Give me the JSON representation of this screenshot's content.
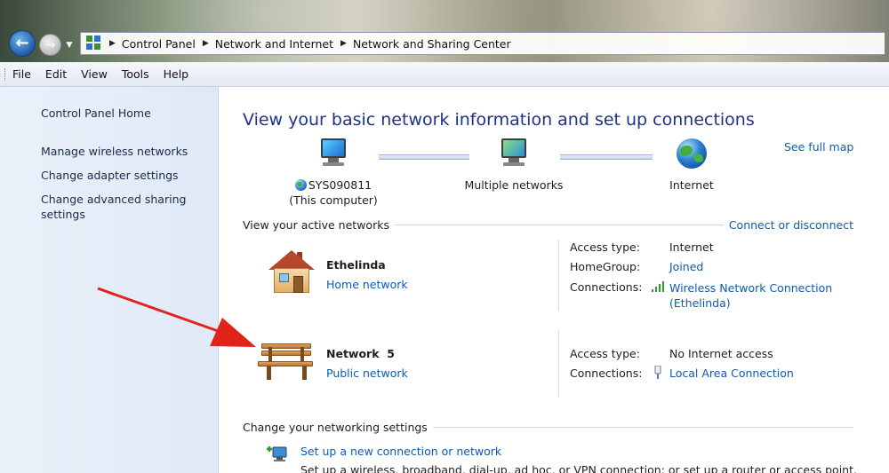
{
  "window": {
    "breadcrumbs": [
      "Control Panel",
      "Network and Internet",
      "Network and Sharing Center"
    ]
  },
  "menu": [
    "File",
    "Edit",
    "View",
    "Tools",
    "Help"
  ],
  "sidebar": {
    "home": "Control Panel Home",
    "links": [
      "Manage wireless networks",
      "Change adapter settings",
      "Change advanced sharing settings"
    ]
  },
  "main": {
    "heading": "View your basic network information and set up connections",
    "see_full_map": "See full map",
    "map": {
      "computer_name": "SYS090811",
      "computer_sub": "(This computer)",
      "middle": "Multiple networks",
      "internet": "Internet"
    },
    "active_networks": {
      "title": "View your active networks",
      "action": "Connect or disconnect",
      "networks": [
        {
          "name": "Ethelinda",
          "type": "Home network",
          "icon": "house-icon",
          "props": [
            {
              "label": "Access type:",
              "value": "Internet",
              "link": false
            },
            {
              "label": "HomeGroup:",
              "value": "Joined",
              "link": true
            },
            {
              "label": "Connections:",
              "value": "Wireless Network Connection",
              "value2": "(Ethelinda)",
              "link": true,
              "icon": "wifi-signal-icon"
            }
          ]
        },
        {
          "name": "Network  5",
          "type": "Public network",
          "icon": "bench-icon",
          "props": [
            {
              "label": "Access type:",
              "value": "No Internet access",
              "link": false
            },
            {
              "label": "Connections:",
              "value": "Local Area Connection",
              "link": true,
              "icon": "ethernet-plug-icon"
            }
          ]
        }
      ]
    },
    "change_settings": {
      "title": "Change your networking settings",
      "setup_link": "Set up a new connection or network",
      "setup_desc": "Set up a wireless, broadband, dial-up, ad hoc, or VPN connection; or set up a router or access point."
    }
  },
  "colors": {
    "link": "#0b5cb4",
    "heading": "#1e3287",
    "sidebar_bg": "#e4edf8",
    "annotation_arrow": "#e2231a"
  }
}
